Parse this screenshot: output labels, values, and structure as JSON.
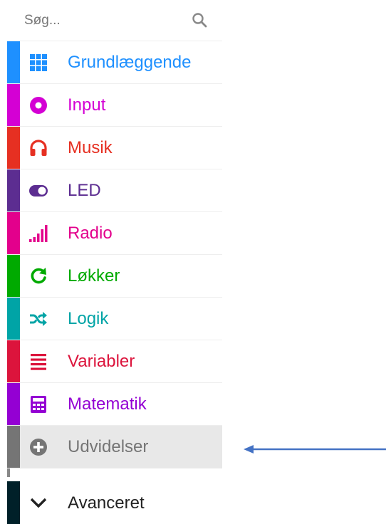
{
  "search": {
    "placeholder": "Søg...",
    "icon": "search-icon"
  },
  "categories": [
    {
      "label": "Grundlæggende",
      "color": "#1e90ff",
      "icon": "grid-icon"
    },
    {
      "label": "Input",
      "color": "#d400d4",
      "icon": "circle-target-icon"
    },
    {
      "label": "Musik",
      "color": "#e63022",
      "icon": "headphones-icon"
    },
    {
      "label": "LED",
      "color": "#5c2d91",
      "icon": "toggle-icon"
    },
    {
      "label": "Radio",
      "color": "#e3008c",
      "icon": "signal-bars-icon"
    },
    {
      "label": "Løkker",
      "color": "#00aa00",
      "icon": "refresh-icon"
    },
    {
      "label": "Logik",
      "color": "#00a4a6",
      "icon": "shuffle-icon"
    },
    {
      "label": "Variabler",
      "color": "#dc143c",
      "icon": "list-icon"
    },
    {
      "label": "Matematik",
      "color": "#9400d3",
      "icon": "calculator-icon"
    },
    {
      "label": "Udvidelser",
      "color": "#757575",
      "icon": "plus-circle-icon",
      "selected": true
    }
  ],
  "advanced": {
    "label": "Avanceret",
    "color": "#002029",
    "icon": "chevron-down-icon"
  },
  "annotation": {
    "arrow_color": "#4472c4"
  }
}
